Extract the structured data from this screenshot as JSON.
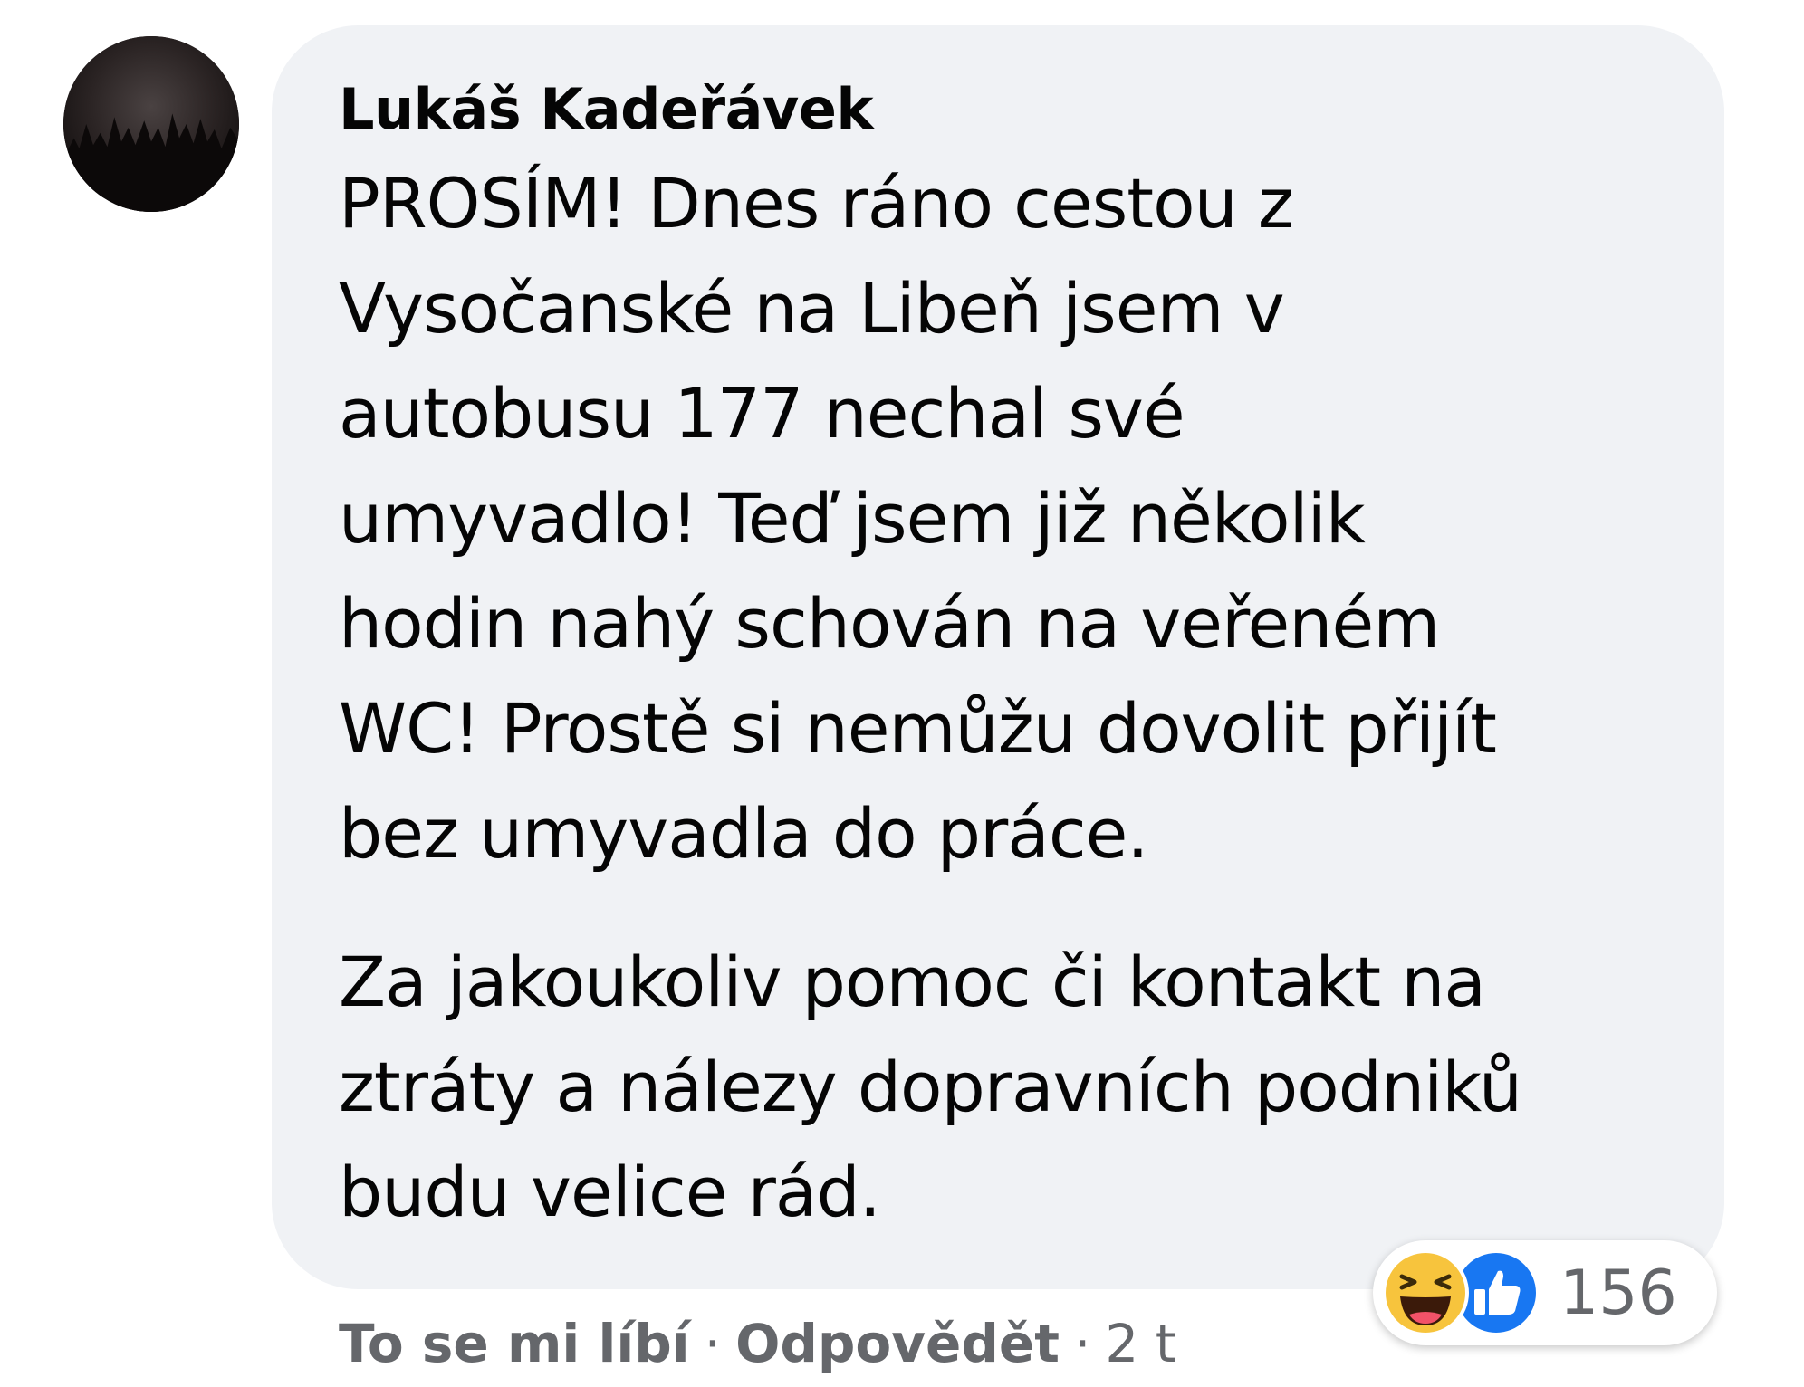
{
  "comment": {
    "author": "Lukáš Kadeřávek",
    "paragraphs": [
      {
        "lines": [
          "PROSÍM! Dnes ráno cestou z",
          "Vysočanské na Libeň jsem v",
          "autobusu 177 nechal své",
          "umyvadlo! Teď jsem již několik",
          "hodin nahý schován na veřeném",
          "WC! Prostě si nemůžu dovolit přijít",
          "bez umyvadla do práce."
        ]
      },
      {
        "lines": [
          "Za jakoukoliv pomoc či kontakt na",
          "ztráty a nálezy dopravních podniků",
          "budu velice rád."
        ]
      }
    ]
  },
  "actions": {
    "like_label": "To se mi líbí",
    "separator": "·",
    "reply_label": "Odpovědět",
    "timestamp": "2 t"
  },
  "reactions": {
    "icons": [
      "haha-icon",
      "like-icon"
    ],
    "count": "156"
  },
  "colors": {
    "bubble_background": "#f0f2f5",
    "text": "#050505",
    "secondary_text": "#65676b",
    "like_blue": "#1877f2",
    "haha_yellow": "#f7c43d"
  }
}
